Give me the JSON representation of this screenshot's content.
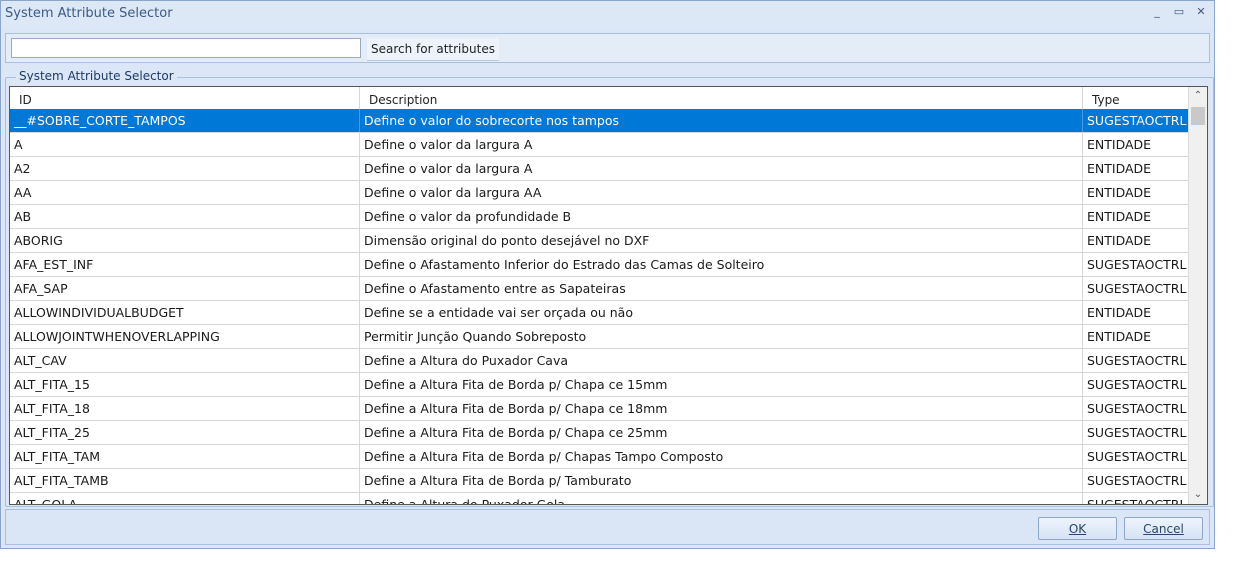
{
  "window": {
    "title": "System Attribute Selector",
    "minimize": "_",
    "restore": "▭",
    "close": "✕"
  },
  "search": {
    "value": "",
    "button_label": "Search for attributes"
  },
  "group": {
    "label": "System Attribute Selector"
  },
  "table": {
    "columns": [
      "ID",
      "Description",
      "Type"
    ],
    "rows": [
      {
        "id": "__#SOBRE_CORTE_TAMPOS",
        "description": "Define o valor do sobrecorte nos tampos",
        "type": "SUGESTAOCTRL",
        "selected": true
      },
      {
        "id": "A",
        "description": "Define o valor da largura A",
        "type": "ENTIDADE"
      },
      {
        "id": "A2",
        "description": "Define o valor da largura A",
        "type": "ENTIDADE"
      },
      {
        "id": "AA",
        "description": "Define o valor da largura AA",
        "type": "ENTIDADE"
      },
      {
        "id": "AB",
        "description": "Define o valor da profundidade B",
        "type": "ENTIDADE"
      },
      {
        "id": "ABORIG",
        "description": "Dimensão original do ponto desejável no DXF",
        "type": "ENTIDADE"
      },
      {
        "id": "AFA_EST_INF",
        "description": "Define o Afastamento Inferior do Estrado das Camas de Solteiro",
        "type": "SUGESTAOCTRL"
      },
      {
        "id": "AFA_SAP",
        "description": "Define o Afastamento entre as Sapateiras",
        "type": "SUGESTAOCTRL"
      },
      {
        "id": "ALLOWINDIVIDUALBUDGET",
        "description": "Define se a entidade vai ser orçada ou não",
        "type": "ENTIDADE"
      },
      {
        "id": "ALLOWJOINTWHENOVERLAPPING",
        "description": "Permitir Junção Quando Sobreposto",
        "type": "ENTIDADE"
      },
      {
        "id": "ALT_CAV",
        "description": "Define a Altura do Puxador Cava",
        "type": "SUGESTAOCTRL"
      },
      {
        "id": "ALT_FITA_15",
        "description": "Define a Altura Fita de Borda p/ Chapa ce 15mm",
        "type": "SUGESTAOCTRL"
      },
      {
        "id": "ALT_FITA_18",
        "description": "Define a Altura Fita de Borda p/ Chapa ce 18mm",
        "type": "SUGESTAOCTRL"
      },
      {
        "id": "ALT_FITA_25",
        "description": "Define a Altura Fita de Borda p/ Chapa ce 25mm",
        "type": "SUGESTAOCTRL"
      },
      {
        "id": "ALT_FITA_TAM",
        "description": "Define a Altura Fita de Borda p/ Chapas Tampo Composto",
        "type": "SUGESTAOCTRL"
      },
      {
        "id": "ALT_FITA_TAMB",
        "description": "Define a Altura Fita de Borda p/ Tamburato",
        "type": "SUGESTAOCTRL"
      },
      {
        "id": "ALT_GOLA",
        "description": "Define a Altura do Puxador Gola",
        "type": "SUGESTAOCTRL"
      }
    ]
  },
  "scroll": {
    "up": "⌃",
    "down": "⌄"
  },
  "footer": {
    "ok_label": "OK",
    "cancel_label": "Cancel"
  }
}
